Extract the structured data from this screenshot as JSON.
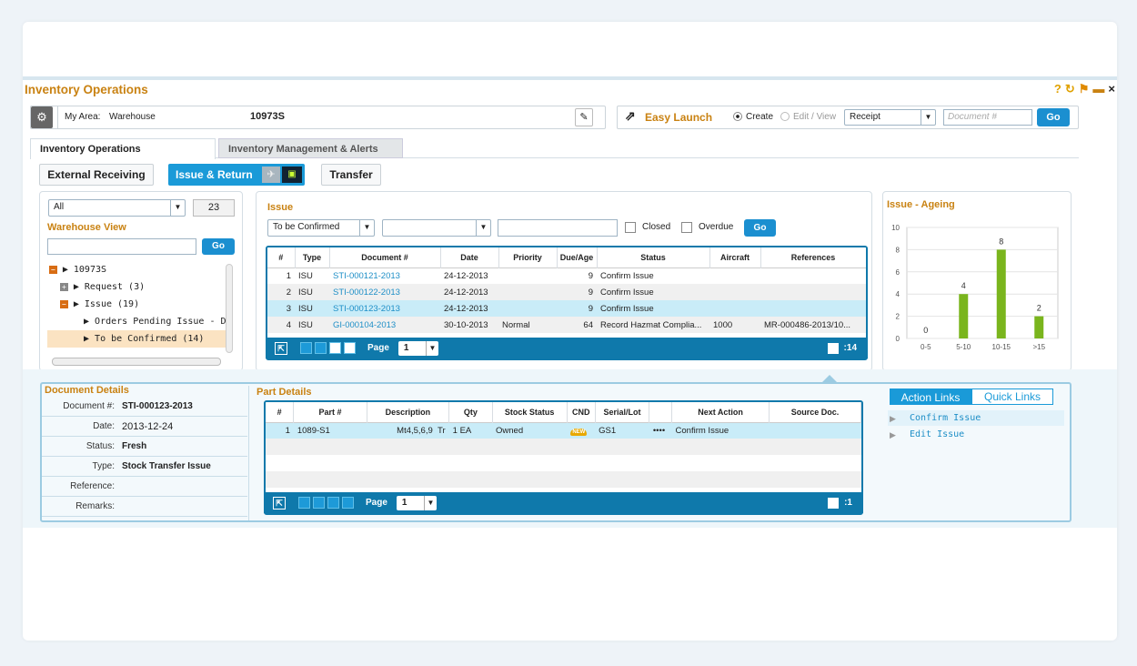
{
  "window": {
    "title": "Inventory Operations",
    "title_icons": [
      "?",
      "↻",
      "⚑",
      "▬",
      "×"
    ]
  },
  "topbar": {
    "my_area_label": "My Area:",
    "my_area_value": "Warehouse",
    "code": "10973S",
    "easy_launch": "Easy Launch",
    "create": "Create",
    "edit_view": "Edit / View",
    "receipt": "Receipt",
    "doc_placeholder": "Document #",
    "go": "Go"
  },
  "tabs": {
    "active": "Inventory Operations",
    "inactive": "Inventory Management & Alerts"
  },
  "subtabs": {
    "external": "External Receiving",
    "issue_return": "Issue & Return",
    "transfer": "Transfer"
  },
  "warehouse": {
    "all": "All",
    "count": "23",
    "title": "Warehouse View",
    "go": "Go",
    "tree": [
      "10973S",
      "Request (3)",
      "Issue (19)",
      "Orders Pending Issue - Due",
      "To be Confirmed  (14)"
    ]
  },
  "issue": {
    "title": "Issue",
    "filter": "To be Confirmed",
    "closed": "Closed",
    "overdue": "Overdue",
    "go": "Go",
    "headers": [
      "#",
      "Type",
      "Document #",
      "Date",
      "Priority",
      "Due/Age",
      "Status",
      "Aircraft",
      "References"
    ],
    "rows": [
      [
        "1",
        "ISU",
        "STI-000121-2013",
        "24-12-2013",
        "",
        "9",
        "Confirm Issue",
        "",
        ""
      ],
      [
        "2",
        "ISU",
        "STI-000122-2013",
        "24-12-2013",
        "",
        "9",
        "Confirm Issue",
        "",
        ""
      ],
      [
        "3",
        "ISU",
        "STI-000123-2013",
        "24-12-2013",
        "",
        "9",
        "Confirm Issue",
        "",
        ""
      ],
      [
        "4",
        "ISU",
        "GI-000104-2013",
        "30-10-2013",
        "Normal",
        "64",
        "Record Hazmat Complia...",
        "1000",
        "MR-000486-2013/10..."
      ]
    ],
    "page_label": "Page",
    "page": "1",
    "total": ":14"
  },
  "ageing": {
    "title": "Issue - Ageing"
  },
  "chart_data": {
    "type": "bar",
    "categories": [
      "0-5",
      "5-10",
      "10-15",
      ">15"
    ],
    "values": [
      0,
      4,
      8,
      2
    ],
    "ylim": [
      0,
      10
    ],
    "yticks": [
      "0",
      "2",
      "4",
      "6",
      "8",
      "10"
    ],
    "color": "#7ab51d"
  },
  "doc": {
    "title": "Document Details",
    "rows": [
      [
        "Document #:",
        "STI-000123-2013"
      ],
      [
        "Date:",
        "2013-12-24"
      ],
      [
        "Status:",
        "Fresh"
      ],
      [
        "Type:",
        "Stock Transfer Issue"
      ],
      [
        "Reference:",
        ""
      ],
      [
        "Remarks:",
        ""
      ]
    ]
  },
  "part": {
    "title": "Part Details",
    "headers": [
      "#",
      "Part #",
      "Description",
      "Qty",
      "Stock Status",
      "CND",
      "Serial/Lot",
      "",
      "Next Action",
      "Source Doc."
    ],
    "row": [
      "1",
      "1089-S1",
      "Mt4,5,6,9",
      "Tr",
      "1 EA",
      "Owned",
      "NEW",
      "GS1",
      "••••",
      "Confirm Issue"
    ],
    "page_label": "Page",
    "page": "1",
    "total": ":1"
  },
  "links": {
    "tab1": "Action Links",
    "tab2": "Quick Links",
    "items": [
      "Confirm Issue",
      "Edit Issue"
    ]
  }
}
